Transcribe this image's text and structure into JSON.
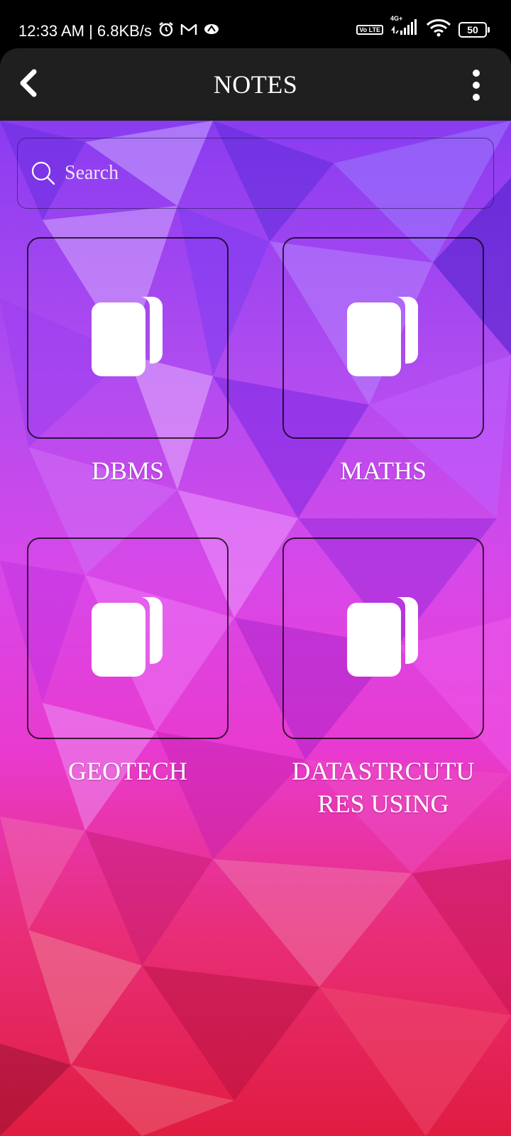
{
  "status_bar": {
    "time_speed": "12:33 AM | 6.8KB/s",
    "alarm_icon": "alarm-clock-icon",
    "gmail_icon": "gmail-icon",
    "app_icon": "app-notification-icon",
    "volte": "Vo LTE",
    "network": "4G+",
    "battery": "50"
  },
  "app_bar": {
    "title": "NOTES",
    "back_icon": "chevron-left-icon",
    "menu_icon": "more-vertical-icon"
  },
  "search": {
    "placeholder": "Search"
  },
  "notes": [
    {
      "label": "DBMS",
      "icon": "book-icon"
    },
    {
      "label": "MATHS",
      "icon": "book-icon"
    },
    {
      "label": "GEOTECH",
      "icon": "book-icon"
    },
    {
      "label": "DATASTRCUTURES USING",
      "icon": "book-icon"
    }
  ],
  "colors": {
    "app_bar": "#1f1f1f",
    "status_bar": "#000000",
    "background_top": "#8a3cf0",
    "background_mid": "#e03ae8",
    "background_bottom": "#e8204a"
  }
}
